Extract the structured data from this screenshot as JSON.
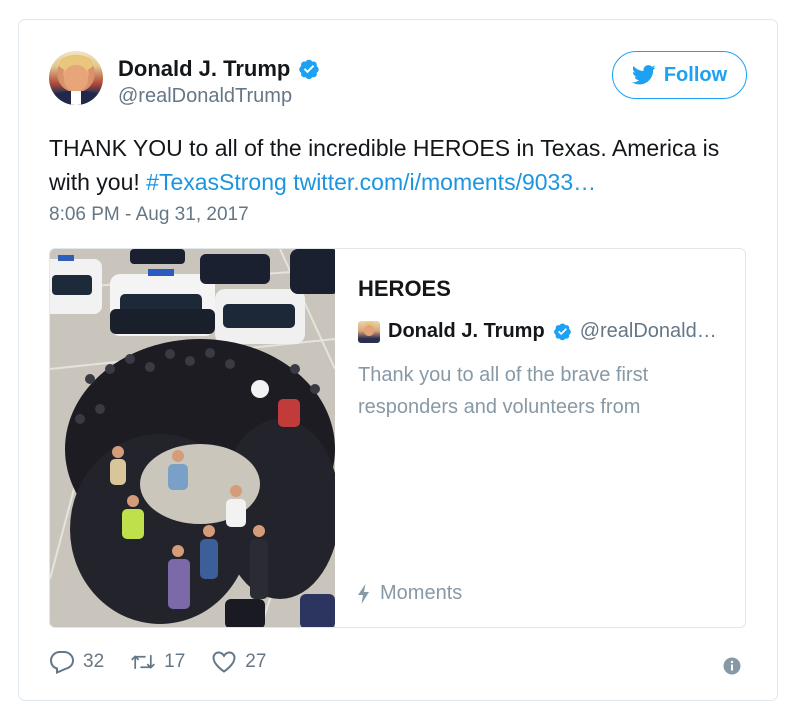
{
  "tweet": {
    "author_name": "Donald J. Trump",
    "author_handle": "@realDonaldTrump",
    "follow_label": "Follow",
    "text_main": "THANK YOU to all of the incredible HEROES in Texas. America is with you! ",
    "hashtag": "#TexasStrong",
    "link": "twitter.com/i/moments/9033…",
    "timestamp": "8:06 PM - Aug 31, 2017"
  },
  "moment": {
    "title": "HEROES",
    "author_name": "Donald J. Trump",
    "author_handle": "@realDonald…",
    "description": "Thank you to all of the brave first responders and volunteers from",
    "footer_label": "Moments"
  },
  "actions": {
    "replies": "32",
    "retweets": "17",
    "likes": "27"
  },
  "colors": {
    "accent": "#1da1f2",
    "link": "#1b95e0",
    "muted": "#657786",
    "border": "#e1e8ed"
  },
  "icons": [
    "verified-icon",
    "twitter-bird-icon",
    "bolt-icon",
    "reply-icon",
    "retweet-icon",
    "like-icon",
    "info-icon"
  ]
}
